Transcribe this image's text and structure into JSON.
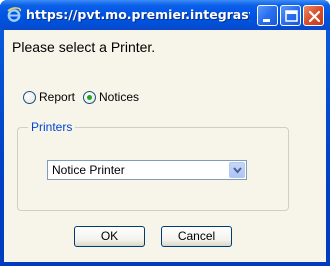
{
  "window": {
    "title": "https://pvt.mo.premier.integrasys...",
    "icon": "ie-icon"
  },
  "dialog": {
    "heading": "Please select a Printer.",
    "radio_report_label": "Report",
    "radio_notices_label": "Notices",
    "selected_radio": "Notices",
    "printers_legend": "Printers",
    "printer_selected": "Notice Printer",
    "ok_label": "OK",
    "cancel_label": "Cancel"
  },
  "colors": {
    "titlebar": "#0054e3",
    "client_bg": "#f7f4ea",
    "legend_text": "#0046d5",
    "radio_dot": "#2aa022"
  }
}
